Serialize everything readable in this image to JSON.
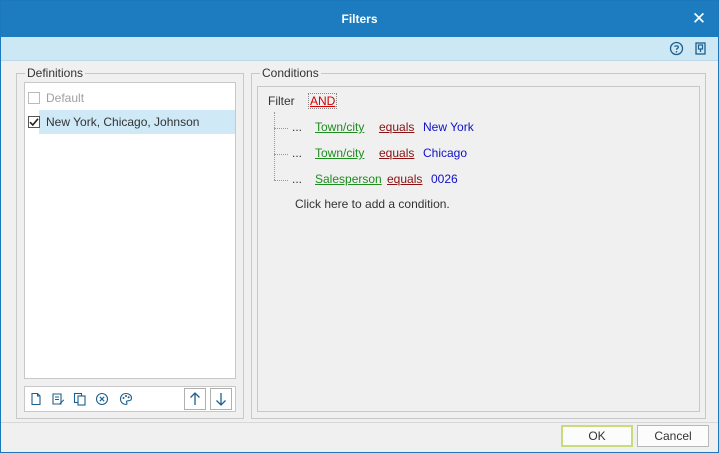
{
  "window": {
    "title": "Filters",
    "close_glyph": "✕"
  },
  "toolbar": {
    "icons": [
      "help-icon",
      "pin-icon"
    ]
  },
  "definitions": {
    "legend": "Definitions",
    "items": [
      {
        "label": "Default",
        "checked": false,
        "disabled": true
      },
      {
        "label": "New York, Chicago, Johnson",
        "checked": true,
        "selected": true
      }
    ],
    "toolbar_icons": [
      "new-icon",
      "edit-icon",
      "copy-icon",
      "delete-icon",
      "palette-icon",
      "arrow-up-icon",
      "arrow-down-icon"
    ]
  },
  "conditions": {
    "legend": "Conditions",
    "filter_label": "Filter",
    "group_operator": "AND",
    "rows": [
      {
        "ellipsis": "...",
        "field": "Town/city",
        "operator": "equals",
        "value": "New York"
      },
      {
        "ellipsis": "...",
        "field": "Town/city",
        "operator": "equals",
        "value": "Chicago"
      },
      {
        "ellipsis": "...",
        "field": "Salesperson",
        "operator": "equals",
        "value": "0026"
      }
    ],
    "add_condition_text": "Click here to add a condition."
  },
  "buttons": {
    "ok": "OK",
    "cancel": "Cancel"
  }
}
